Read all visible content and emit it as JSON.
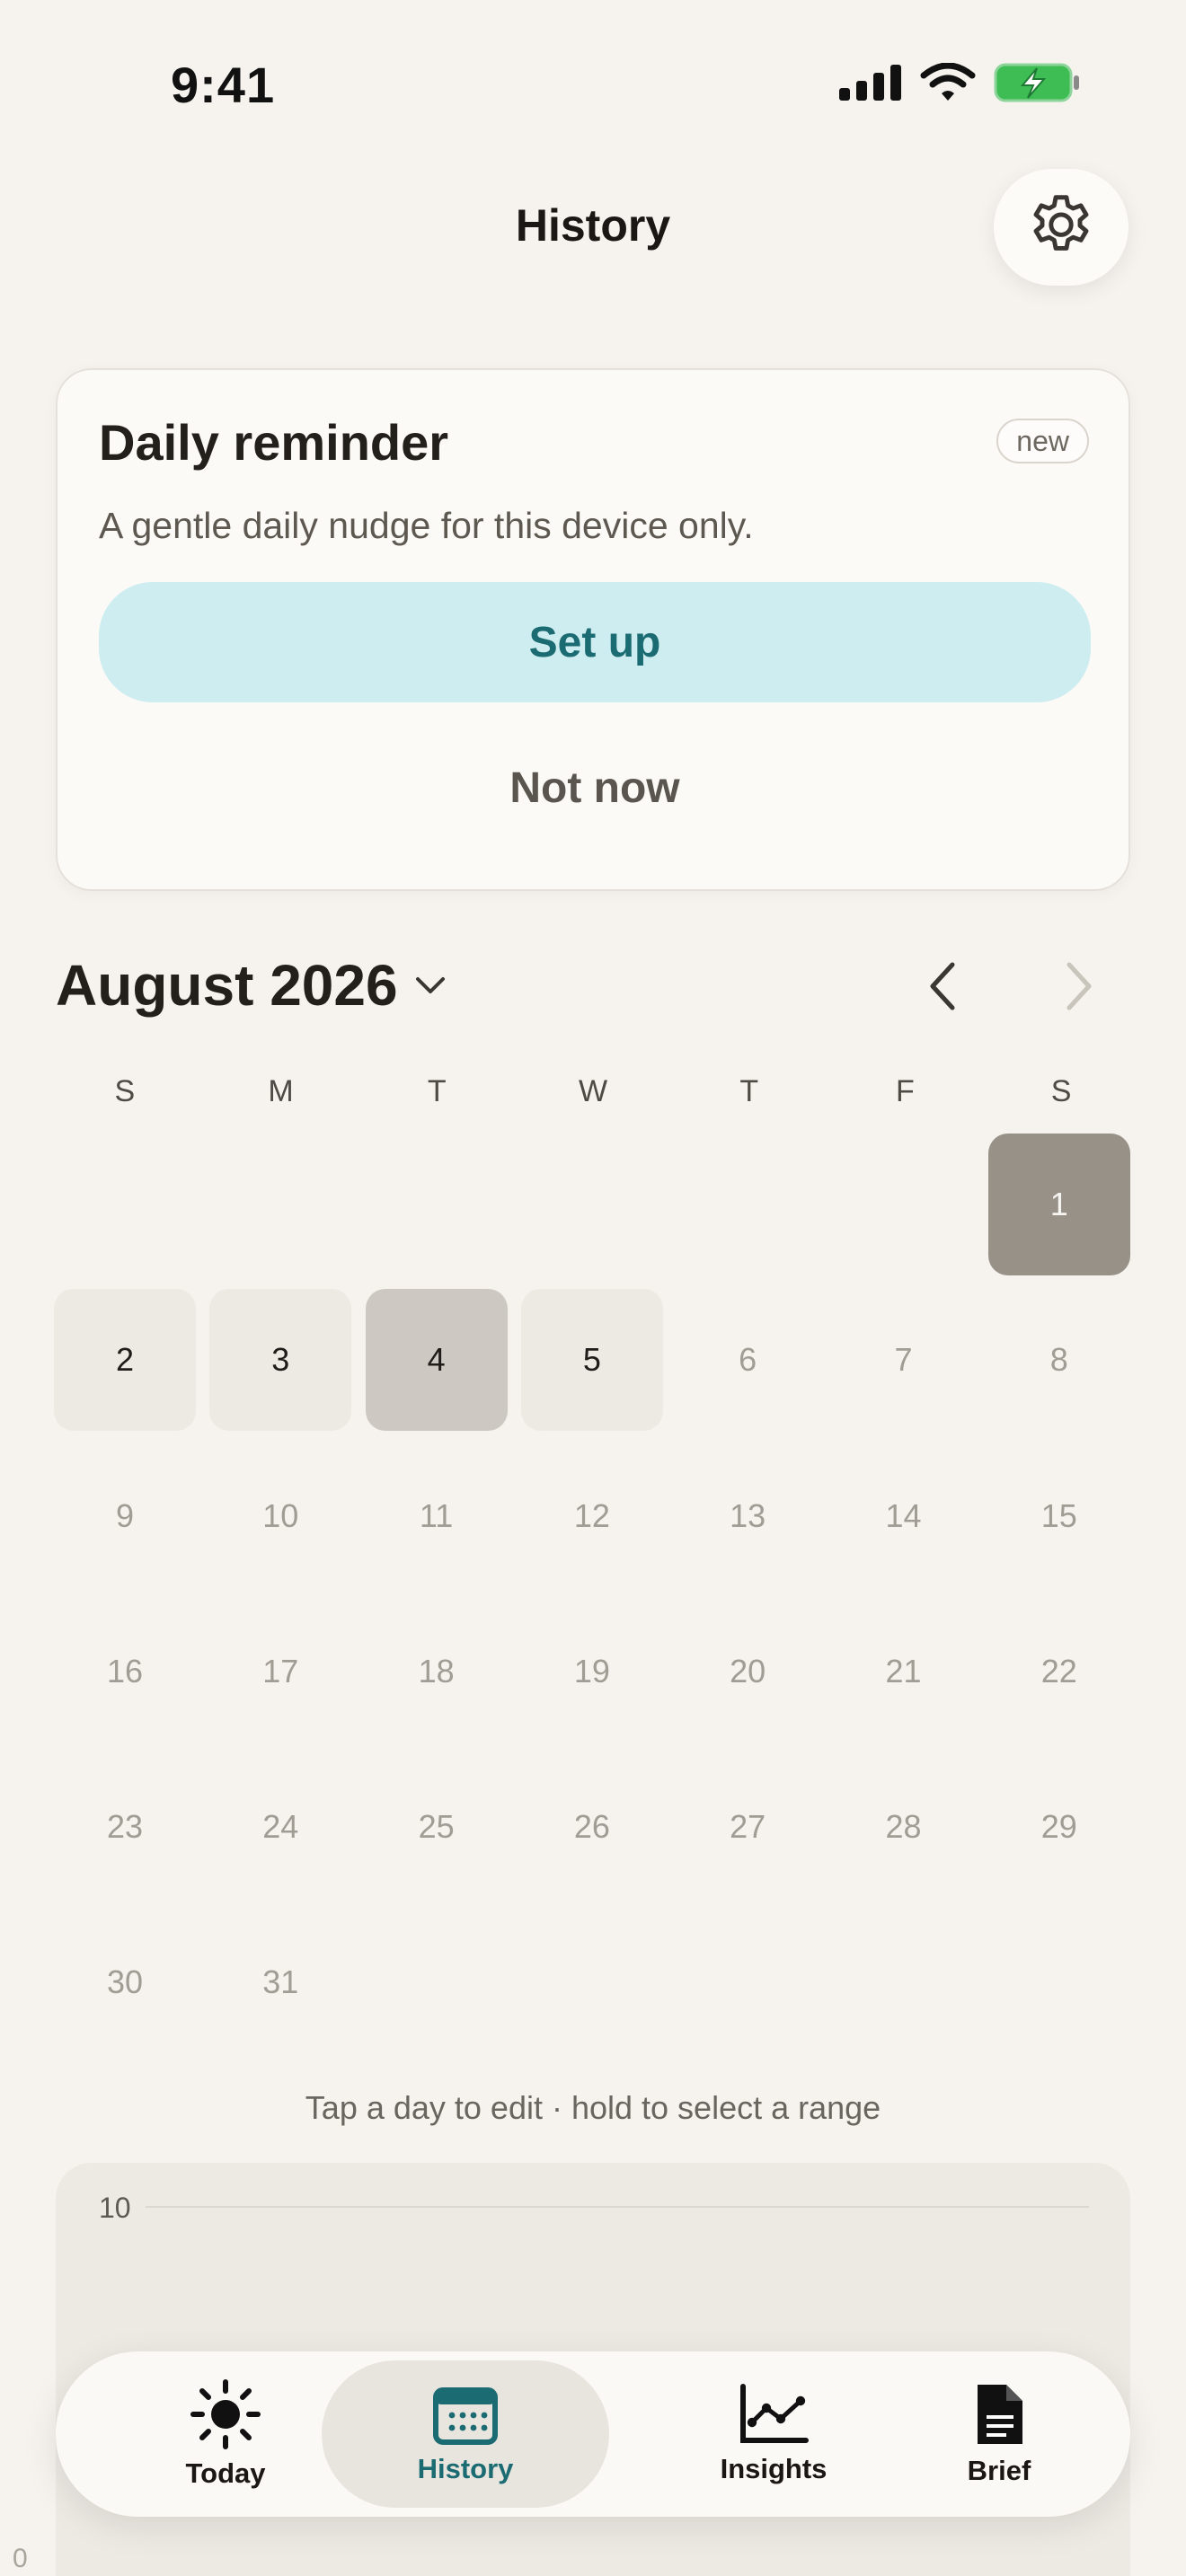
{
  "status": {
    "time": "9:41",
    "icons": [
      "signal-icon",
      "wifi-icon",
      "battery-charging-icon"
    ],
    "battery_color": "#3ebd54"
  },
  "header": {
    "title": "History",
    "settings_icon": "gear-icon"
  },
  "reminder_card": {
    "title": "Daily reminder",
    "badge": "new",
    "description": "A gentle daily nudge for this device only.",
    "setup_label": "Set up",
    "dismiss_label": "Not now"
  },
  "calendar": {
    "month_label": "August 2026",
    "weekdays": [
      "S",
      "M",
      "T",
      "W",
      "T",
      "F",
      "S"
    ],
    "leading_blanks": 6,
    "days": [
      "1",
      "2",
      "3",
      "4",
      "5",
      "6",
      "7",
      "8",
      "9",
      "10",
      "11",
      "12",
      "13",
      "14",
      "15",
      "16",
      "17",
      "18",
      "19",
      "20",
      "21",
      "22",
      "23",
      "24",
      "25",
      "26",
      "27",
      "28",
      "29",
      "30",
      "31"
    ],
    "selected_day": "1",
    "today_day": "4",
    "logged_days": [
      "2",
      "3",
      "5"
    ],
    "hint": "Tap a day to edit · hold to select a range"
  },
  "chart": {
    "y_max_label": "10",
    "y_min_label": "0"
  },
  "tabs": [
    {
      "label": "Today",
      "icon": "sun-icon",
      "active": false
    },
    {
      "label": "History",
      "icon": "calendar-icon",
      "active": true
    },
    {
      "label": "Insights",
      "icon": "line-chart-icon",
      "active": false
    },
    {
      "label": "Brief",
      "icon": "document-icon",
      "active": false
    }
  ],
  "colors": {
    "accent": "#1b6b72",
    "accent_bg": "#cdedf0",
    "background": "#f6f3ee"
  }
}
